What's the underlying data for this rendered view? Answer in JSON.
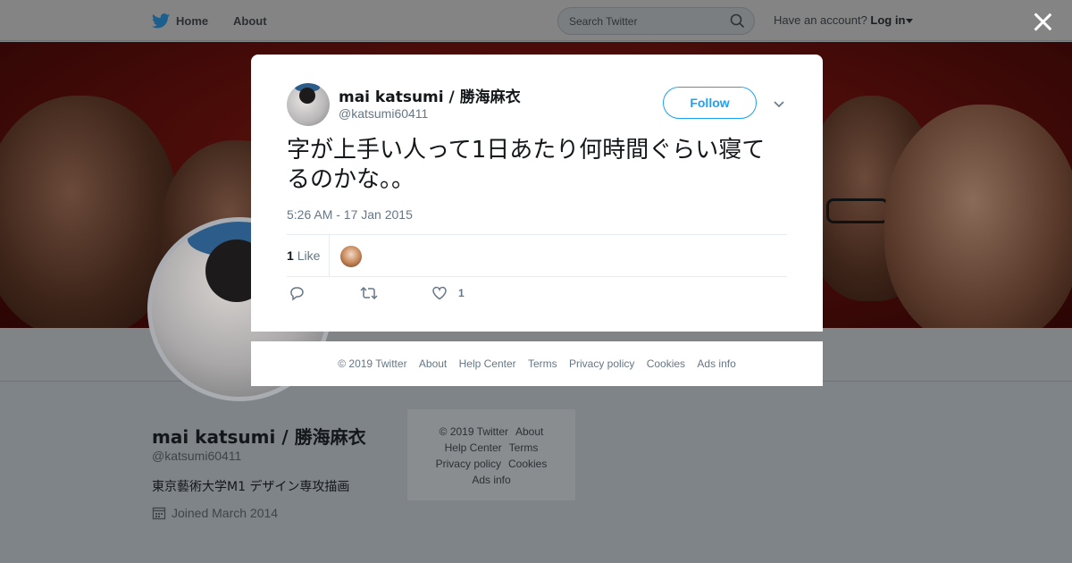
{
  "nav": {
    "home_label": "Home",
    "about_label": "About",
    "search_placeholder": "Search Twitter",
    "account_prompt": "Have an account?",
    "login_label": "Log in"
  },
  "profile": {
    "name": "mai katsumi / 勝海麻衣",
    "handle": "@katsumi60411",
    "bio": "東京藝術大学M1 デザイン専攻描画",
    "joined": "Joined March 2014"
  },
  "side_footer": {
    "copyright": "© 2019 Twitter",
    "about": "About",
    "help": "Help Center",
    "terms": "Terms",
    "privacy": "Privacy policy",
    "cookies": "Cookies",
    "ads": "Ads info"
  },
  "tweet": {
    "author_name": "mai katsumi / 勝海麻衣",
    "author_handle": "@katsumi60411",
    "follow_label": "Follow",
    "text": "字が上手い人って1日あたり何時間ぐらい寝てるのかな。。",
    "timestamp": "5:26 AM - 17 Jan 2015",
    "like_count": "1",
    "like_label": "Like",
    "action_like_count": "1"
  },
  "modal_footer": {
    "copyright": "© 2019 Twitter",
    "about": "About",
    "help": "Help Center",
    "terms": "Terms",
    "privacy": "Privacy policy",
    "cookies": "Cookies",
    "ads": "Ads info"
  },
  "colors": {
    "twitter_blue": "#1da1f2",
    "overlay": "#7f8489",
    "secondary_text": "#657786"
  }
}
